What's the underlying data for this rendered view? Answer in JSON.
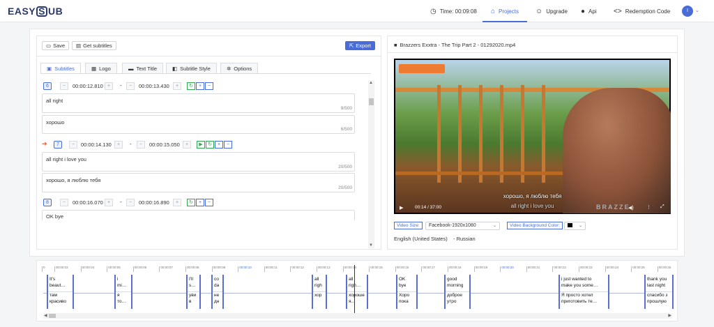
{
  "header": {
    "logo_left": "EASY",
    "logo_mid": "S",
    "logo_right": "UB",
    "time_label": "Time: 00:09:08",
    "nav": [
      "Projects",
      "Upgrade",
      "Api",
      "Redemption Code"
    ],
    "avatar_initial": "I",
    "accent_color": "#4a6cd6"
  },
  "toolbar": {
    "save_label": "Save",
    "get_subtitles_label": "Get subtitles",
    "export_label": "Export"
  },
  "tabs": [
    "Subtitles",
    "Logo",
    "Text Title",
    "Subtitle Style",
    "Options"
  ],
  "subtitles": [
    {
      "index": "6",
      "start": "00:00:12.810",
      "end": "00:00:13.430",
      "text": "all right",
      "count": "9/500",
      "translation": "хорошо",
      "tcount": "6/500"
    },
    {
      "index": "7",
      "start": "00:00:14.130",
      "end": "00:00:15.050",
      "text": "all right i love you",
      "count": "20/500",
      "translation": "хорошо, я люблю тебя",
      "tcount": "20/500"
    },
    {
      "index": "8",
      "start": "00:00:16.070",
      "end": "00:00:16.890",
      "text": "OK bye"
    }
  ],
  "separator": "-",
  "video": {
    "title": "Brazzers Exxtra - The Trip Part 2 - 01292020.mp4",
    "subtitle_line_1": "хорошо, я люблю тебя",
    "subtitle_line_2": "all right i love you",
    "time": "00:14 / 37:00",
    "brand": "BRAZZE",
    "video_size_label": "Video Size:",
    "video_size_value": "Facebook-1920x1080",
    "bg_color_label": "Video Background Color:",
    "bg_color": "#000000",
    "lang_primary": "English (United States)",
    "lang_secondary": "- Russian"
  },
  "timeline": {
    "ticks": [
      "0",
      "00:00:03",
      "00:00:04",
      "00:00:05",
      "00:00:06",
      "00:00:07",
      "00:00:08",
      "00:00:09",
      "00:00:10",
      "00:00:11",
      "00:00:12",
      "00:00:13",
      "00:00:14",
      "00:00:15",
      "00:00:16",
      "00:00:17",
      "00:00:18",
      "00:00:19",
      "00:00:20",
      "00:00:21",
      "00:00:22",
      "00:00:23",
      "00:00:24",
      "00:00:25",
      "00:00:26"
    ],
    "clips": [
      {
        "top": "It's\nbeaut…",
        "bottom": "там\nкрасиво"
      },
      {
        "top": "i\nmi…",
        "bottom": "я\nто…"
      },
      {
        "top": "I'll\ns…",
        "bottom": "уви\nв"
      },
      {
        "top": "co\nda",
        "bottom": "не\nдн"
      },
      {
        "top": "all\nrigh",
        "bottom": "хор"
      },
      {
        "top": "all\nrigh…",
        "bottom": "хороше\nя…"
      },
      {
        "top": "OK\nbye",
        "bottom": "Хоро\nпока"
      },
      {
        "top": "good\nmorning",
        "bottom": "доброе\nутро"
      },
      {
        "top": "i just wanted to\nmake you some…",
        "bottom": "Я просто хотел\nприготовить те…"
      },
      {
        "top": "thank you\nlast night",
        "bottom": "спасибо з\nпрошлую"
      }
    ]
  }
}
